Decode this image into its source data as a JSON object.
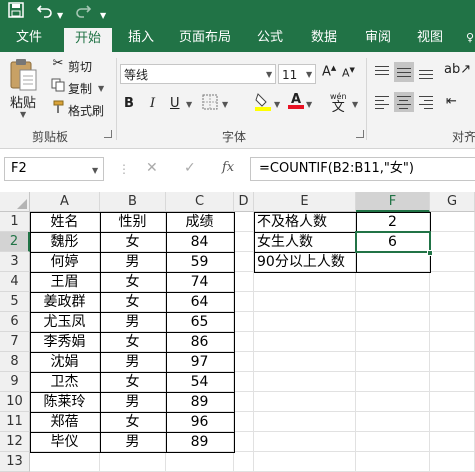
{
  "qat": {
    "save_icon": "save-icon",
    "undo_icon": "undo-icon",
    "redo_icon": "redo-icon",
    "customize_icon": "customize-qat-icon"
  },
  "tabs": [
    "文件",
    "开始",
    "插入",
    "页面布局",
    "公式",
    "数据",
    "审阅",
    "视图"
  ],
  "active_tab": "开始",
  "ribbon": {
    "clipboard": {
      "paste": "粘贴",
      "cut": "剪切",
      "copy": "复制",
      "format_painter": "格式刷",
      "group": "剪贴板"
    },
    "font": {
      "name": "等线",
      "size": "11",
      "bold": "B",
      "italic": "I",
      "underline": "U",
      "wen": "wén",
      "wen_char": "文",
      "group": "字体"
    },
    "alignment": {
      "group": "对齐"
    }
  },
  "formula_bar": {
    "name_box": "F2",
    "cancel": "✕",
    "enter": "✓",
    "fx": "fx",
    "formula": "=COUNTIF(B2:B11,\"女\")"
  },
  "columns": [
    "A",
    "B",
    "C",
    "D",
    "E",
    "F",
    "G"
  ],
  "rows": [
    "1",
    "2",
    "3",
    "4",
    "5",
    "6",
    "7",
    "8",
    "9",
    "10",
    "11",
    "12",
    "13"
  ],
  "selected": {
    "column": "F",
    "row": "2"
  },
  "cells": {
    "A": [
      "姓名",
      "魏彤",
      "何婷",
      "王眉",
      "姜政群",
      "尤玉凤",
      "李秀娟",
      "沈娟",
      "卫杰",
      "陈莱玲",
      "郑蓓",
      "毕仪"
    ],
    "B": [
      "性别",
      "女",
      "男",
      "女",
      "女",
      "男",
      "女",
      "男",
      "女",
      "男",
      "女",
      "男"
    ],
    "C": [
      "成绩",
      "84",
      "59",
      "74",
      "64",
      "65",
      "86",
      "97",
      "54",
      "89",
      "96",
      "89"
    ],
    "E": [
      "不及格人数",
      "女生人数",
      "90分以上人数"
    ],
    "F": [
      "2",
      "6",
      ""
    ]
  },
  "colors": {
    "accent": "#217346",
    "font_color": "#e81123",
    "highlight": "#ffff00"
  }
}
